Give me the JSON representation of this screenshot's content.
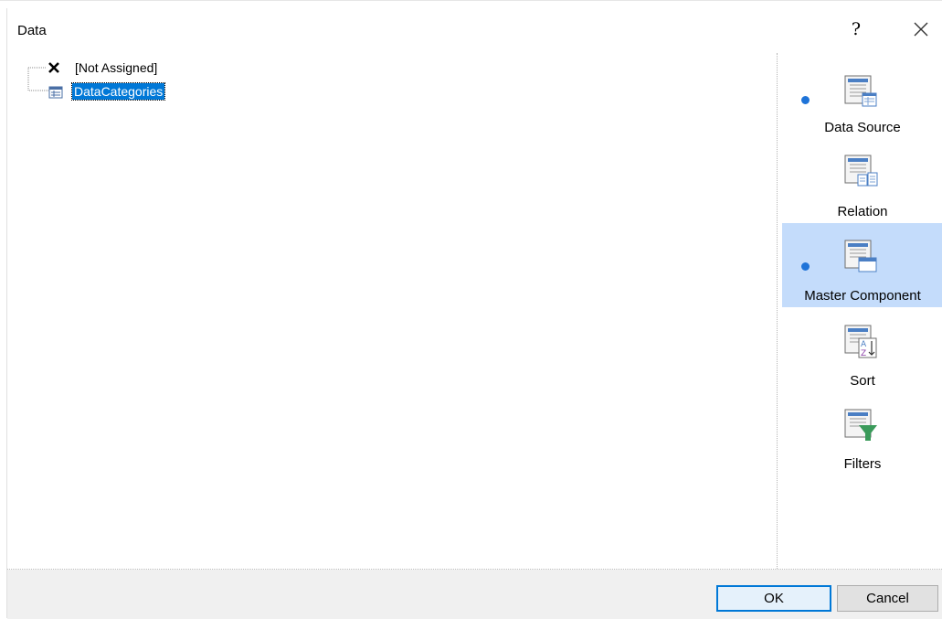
{
  "dialog": {
    "title": "Data",
    "help_label": "?"
  },
  "tree": {
    "items": [
      {
        "label": "[Not Assigned]",
        "icon": "x-icon"
      },
      {
        "label": "DataCategories",
        "icon": "table-icon",
        "selected": true
      }
    ]
  },
  "side_panel": {
    "items": [
      {
        "label": "Data Source",
        "icon": "data-source-icon",
        "indicator": true,
        "active": false
      },
      {
        "label": "Relation",
        "icon": "relation-icon",
        "indicator": false,
        "active": false
      },
      {
        "label": "Master Component",
        "icon": "master-component-icon",
        "indicator": true,
        "active": true
      },
      {
        "label": "Sort",
        "icon": "sort-icon",
        "indicator": false,
        "active": false
      },
      {
        "label": "Filters",
        "icon": "filter-icon",
        "indicator": false,
        "active": false
      }
    ],
    "accent_color": "#1e73d8",
    "active_bg": "#c4dcfb"
  },
  "buttons": {
    "ok_label": "OK",
    "cancel_label": "Cancel"
  }
}
